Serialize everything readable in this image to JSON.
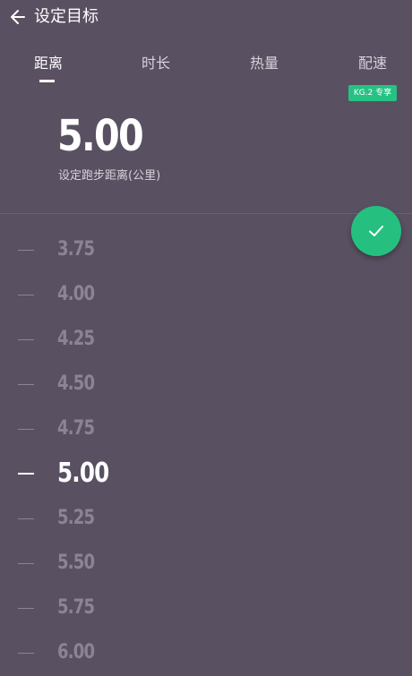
{
  "header": {
    "title": "设定目标",
    "back_icon": "arrow-left-icon"
  },
  "tabs": [
    {
      "label": "距离",
      "active": true
    },
    {
      "label": "时长",
      "active": false
    },
    {
      "label": "热量",
      "active": false
    },
    {
      "label": "配速",
      "active": false
    }
  ],
  "badge": "KG.2 专享",
  "goal": {
    "value": "5.00",
    "caption": "设定跑步距离(公里)"
  },
  "confirm": {
    "icon": "check-icon",
    "color": "#25c07f"
  },
  "picker": {
    "options": [
      "3.75",
      "4.00",
      "4.25",
      "4.50",
      "4.75",
      "5.00",
      "5.25",
      "5.50",
      "5.75",
      "6.00"
    ],
    "selected": "5.00"
  },
  "colors": {
    "background": "#595061",
    "accent": "#25c07f"
  }
}
